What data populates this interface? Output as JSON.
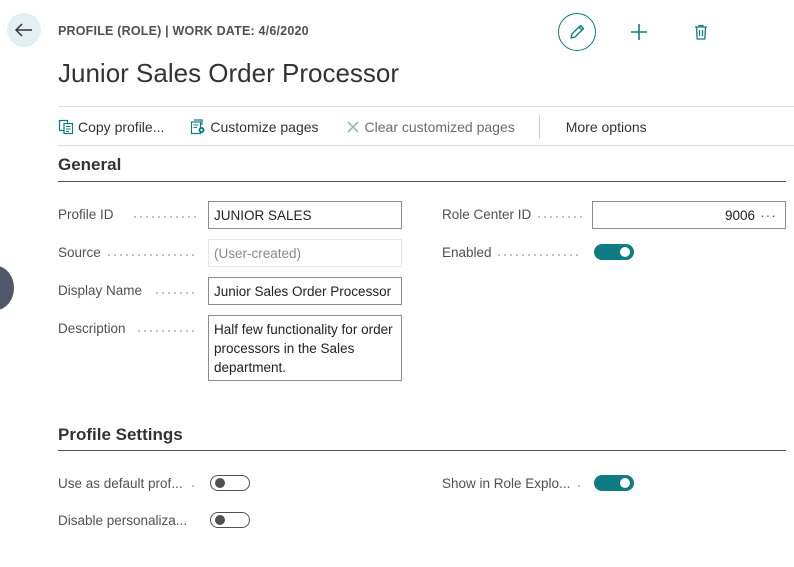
{
  "header": {
    "caption": "PROFILE (ROLE) | WORK DATE: 4/6/2020",
    "title": "Junior Sales Order Processor"
  },
  "icons": {
    "back": "arrow-left-icon",
    "edit": "pencil-icon",
    "new": "plus-icon",
    "delete": "trash-icon",
    "copy": "copy-icon",
    "customize": "customize-pages-icon",
    "clear": "x-icon"
  },
  "colors": {
    "accent": "#0f7b83",
    "back_bg": "#e3eff1",
    "text": "#212121",
    "label": "#505050"
  },
  "actions": {
    "copy_profile": "Copy profile...",
    "customize_pages": "Customize pages",
    "clear_customized": "Clear customized pages",
    "more_options": "More options"
  },
  "general": {
    "title": "General",
    "profile_id": {
      "label": "Profile ID",
      "value": "JUNIOR SALES"
    },
    "source": {
      "label": "Source",
      "value": "(User-created)"
    },
    "display_name": {
      "label": "Display Name",
      "value": "Junior Sales Order Processor"
    },
    "description": {
      "label": "Description",
      "value": "Half few functionality for order processors in the Sales department."
    },
    "role_center_id": {
      "label": "Role Center ID",
      "value": "9006"
    },
    "enabled": {
      "label": "Enabled",
      "value": true
    }
  },
  "profile_settings": {
    "title": "Profile Settings",
    "use_as_default": {
      "label": "Use as default prof...",
      "value": false
    },
    "disable_personalization": {
      "label": "Disable personaliza...",
      "value": false
    },
    "show_in_role_explorer": {
      "label": "Show in Role Explo...",
      "value": true
    }
  }
}
